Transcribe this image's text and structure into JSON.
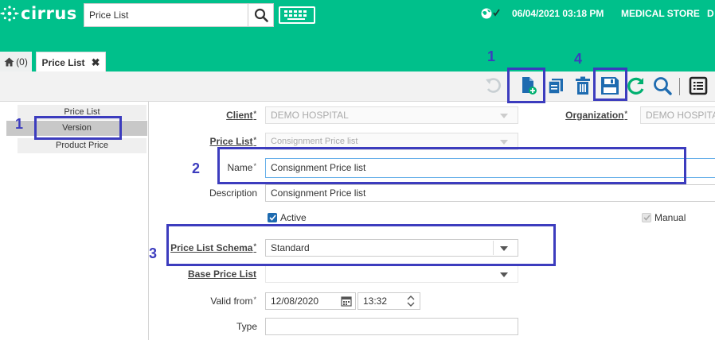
{
  "header": {
    "app_name": "cirrus",
    "search_value": "Price List",
    "datetime": "06/04/2021 03:18 PM",
    "store": "MEDICAL STORE",
    "user_initial": "D",
    "brand_color": "#00c08b"
  },
  "tabs": {
    "home_count": "(0)",
    "active_tab": "Price List",
    "close_icon": "✖"
  },
  "toolbar": {
    "icons": [
      "undo-icon",
      "new-record-icon",
      "copy-icon",
      "delete-icon",
      "save-icon",
      "refresh-icon",
      "search-icon",
      "grid-view-icon"
    ]
  },
  "sidebar": {
    "items": [
      {
        "label": "Price List"
      },
      {
        "label": "Version"
      },
      {
        "label": "Product Price"
      }
    ]
  },
  "form": {
    "client": {
      "label": "Client",
      "value": "DEMO HOSPITAL"
    },
    "organization": {
      "label": "Organization",
      "value": "DEMO HOSPITAL"
    },
    "price_list": {
      "label": "Price List",
      "value": "Consignment Price list"
    },
    "name": {
      "label": "Name",
      "value": "Consignment Price list"
    },
    "description": {
      "label": "Description",
      "value": "Consignment Price list"
    },
    "active": {
      "label": "Active",
      "checked": true
    },
    "manual": {
      "label": "Manual",
      "checked": true
    },
    "price_list_schema": {
      "label": "Price List Schema",
      "value": "Standard"
    },
    "base_price_list": {
      "label": "Base Price List",
      "value": ""
    },
    "valid_from": {
      "label": "Valid from",
      "date": "12/08/2020",
      "time": "13:32"
    },
    "type": {
      "label": "Type",
      "value": ""
    }
  },
  "annotations": {
    "color": "#3c3cbe",
    "labels": [
      "1",
      "4",
      "1",
      "2",
      "3"
    ]
  }
}
